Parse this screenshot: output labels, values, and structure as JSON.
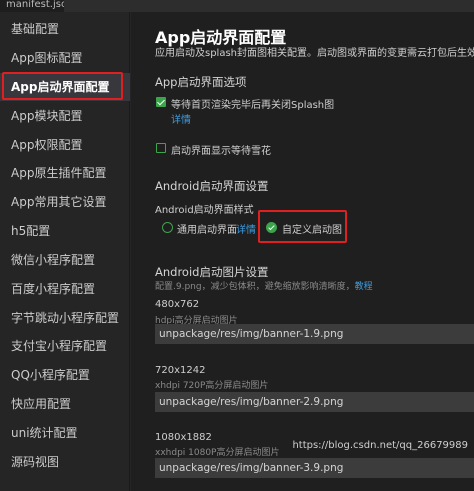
{
  "tab": {
    "label": "manifest.json"
  },
  "sidebar": {
    "items": [
      {
        "label": "基础配置"
      },
      {
        "label": "App图标配置"
      },
      {
        "label": "App启动界面配置"
      },
      {
        "label": "App模块配置"
      },
      {
        "label": "App权限配置"
      },
      {
        "label": "App原生插件配置"
      },
      {
        "label": "App常用其它设置"
      },
      {
        "label": "h5配置"
      },
      {
        "label": "微信小程序配置"
      },
      {
        "label": "百度小程序配置"
      },
      {
        "label": "字节跳动小程序配置"
      },
      {
        "label": "支付宝小程序配置"
      },
      {
        "label": "QQ小程序配置"
      },
      {
        "label": "快应用配置"
      },
      {
        "label": "uni统计配置"
      },
      {
        "label": "源码视图"
      }
    ],
    "active_index": 2
  },
  "main": {
    "title": "App启动界面配置",
    "description": "应用启动及splash封面图相关配置。启动图或界面的变更需云打包后生效，",
    "splash_section": {
      "title": "App启动界面选项",
      "wait_option": {
        "label": "等待首页渲染完毕后再关闭Splash图",
        "checked": true,
        "link": "详情"
      },
      "spinner_option": {
        "label": "启动界面显示等待雪花",
        "checked": false
      }
    },
    "android_style": {
      "title": "Android启动界面设置",
      "subtitle": "Android启动界面样式",
      "option_common": {
        "label": "通用启动界面",
        "link": "详情",
        "checked": false
      },
      "option_custom": {
        "label": "自定义启动图",
        "checked": true
      }
    },
    "android_images": {
      "title": "Android启动图片设置",
      "hint_prefix": "配置.9.png，减少包体积，避免缩放影响清晰度，",
      "hint_link": "教程",
      "images": [
        {
          "size": "480x762",
          "desc": "hdpi高分屏启动图片",
          "path": "unpackage/res/img/banner-1.9.png"
        },
        {
          "size": "720x1242",
          "desc": "xhdpi 720P高分屏启动图片",
          "path": "unpackage/res/img/banner-2.9.png"
        },
        {
          "size": "1080x1882",
          "desc": "xxhdpi 1080P高分屏启动图片",
          "path": "unpackage/res/img/banner-3.9.png"
        }
      ]
    }
  },
  "watermark": "https://blog.csdn.net/qq_26679989",
  "colors": {
    "accent_green": "#3aa54a",
    "link_blue": "#3c9ce0",
    "highlight_red": "#e02020",
    "input_bg": "#3c3c3c"
  }
}
